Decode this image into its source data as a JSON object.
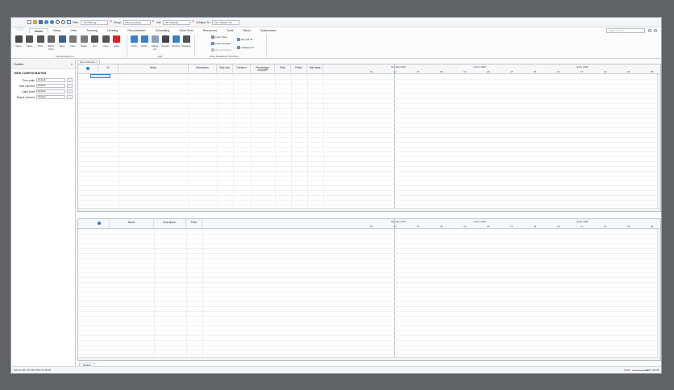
{
  "quickbar": {
    "filter_label": "Filter:",
    "filter_value": "<No Filtering>",
    "group_label": "Group:",
    "group_value": "<No Grouping>",
    "sort_label": "Sort:",
    "sort_value": "<No Sorting>",
    "collapse_label": "Collapse To:",
    "collapse_value": "<No Collapse Ful"
  },
  "logo": "mpp ops",
  "tabs": [
    "Home",
    "Setup",
    "View",
    "Tracking",
    "Leveling",
    "Reconciliation",
    "Scheduling",
    "Short Term",
    "Resources",
    "Tools",
    "Blend",
    "Optimization"
  ],
  "search_placeholder": "Quick search",
  "ribbon": {
    "file": [
      "Open",
      "Close",
      "Print",
      "Batch Print",
      "Save",
      "New",
      "Paste",
      "Cut",
      "Copy",
      "Clear"
    ],
    "file_group": "File Management",
    "edit": [
      "Undo",
      "Redo",
      "Select all",
      "Search",
      "Scroll to",
      "Replace"
    ],
    "edit_group": "Edit",
    "wbs": [
      "Insert Task",
      "Insert Subtask",
      "Group Children",
      "Expand All",
      "Collapse All"
    ],
    "wbs_group": "Work Breakdown Structure"
  },
  "sidebar": {
    "title": "Scatter",
    "section": "VIEW CONFIGURATION",
    "fields": [
      {
        "label": "Time scale",
        "value": "Default"
      },
      {
        "label": "Task columns",
        "value": "Default"
      },
      {
        "label": "Gantt chart",
        "value": "Default"
      },
      {
        "label": "Report columns",
        "value": "Default"
      }
    ]
  },
  "doc_tab": "New Schedule 1",
  "top_grid": {
    "columns": [
      "ID",
      "Name",
      "Description",
      "Task size",
      "Duration",
      "Percentage complete",
      "Start",
      "Finish",
      "Task state"
    ],
    "months": [
      "febbraio 2022",
      "marzo 2022",
      "aprile 2022",
      "maggio 2022",
      "giugno 2022",
      "luglio 2022"
    ],
    "days": [
      "13",
      "20",
      "27",
      "06",
      "13",
      "20",
      "27",
      "03",
      "10",
      "17",
      "24",
      "01",
      "08",
      "15",
      "22",
      "29"
    ]
  },
  "bottom_grid": {
    "columns": [
      "Name",
      "Description",
      "Point"
    ]
  },
  "bottom_tab": "Default",
  "status": "Saved: Mon 22 Mar 2022 12:00:00",
  "zoom_label": "Zoom",
  "zoom_right": "Year / Month"
}
